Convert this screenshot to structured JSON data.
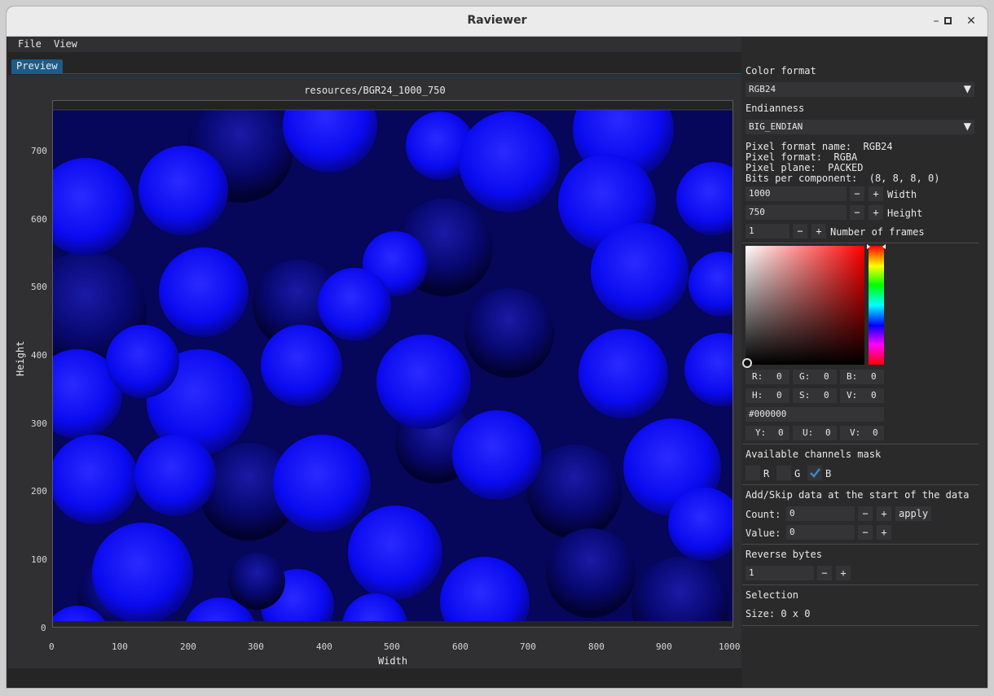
{
  "window": {
    "title": "Raviewer"
  },
  "menu": {
    "file": "File",
    "view": "View"
  },
  "tabs": {
    "preview": "Preview"
  },
  "plot": {
    "title": "resources/BGR24_1000_750",
    "xlabel": "Width",
    "ylabel": "Height",
    "xticks": [
      "0",
      "100",
      "200",
      "300",
      "400",
      "500",
      "600",
      "700",
      "800",
      "900",
      "1000"
    ],
    "yticks": [
      "0",
      "100",
      "200",
      "300",
      "400",
      "500",
      "600",
      "700"
    ]
  },
  "panel": {
    "color_format_label": "Color format",
    "color_format_value": "RGB24",
    "endianness_label": "Endianness",
    "endianness_value": "BIG_ENDIAN",
    "pixel_format_name": "Pixel format name:  RGB24",
    "pixel_format": "Pixel format:  RGBA",
    "pixel_plane": "Pixel plane:  PACKED",
    "bits_per_component": "Bits per component:  (8, 8, 8, 0)",
    "width_value": "1000",
    "width_label": "Width",
    "height_value": "750",
    "height_label": "Height",
    "frames_value": "1",
    "frames_label": "Number of frames",
    "minus": "−",
    "plus": "+",
    "rgb": {
      "r": "R:",
      "r_val": "0",
      "g": "G:",
      "g_val": "0",
      "b": "B:",
      "b_val": "0"
    },
    "hsv": {
      "h": "H:",
      "h_val": "0",
      "s": "S:",
      "s_val": "0",
      "v": "V:",
      "v_val": "0"
    },
    "hex": "#000000",
    "yuv": {
      "y": "Y:",
      "y_val": "0",
      "u": "U:",
      "u_val": "0",
      "v": "V:",
      "v_val": "0"
    },
    "channels_label": "Available channels mask",
    "channel_r": "R",
    "channel_g": "G",
    "channel_b": "B",
    "channel_b_checked": true,
    "addskip_label": "Add/Skip data at the start of the data",
    "count_label": "Count:",
    "count_value": "0",
    "apply": "apply",
    "value_label": "Value:",
    "value_value": "0",
    "reverse_label": "Reverse bytes",
    "reverse_value": "1",
    "selection_label": "Selection",
    "selection_size": "Size: 0 x 0"
  },
  "colors": {
    "accent": "#1e5b88",
    "image_tint": "#0000ff"
  }
}
